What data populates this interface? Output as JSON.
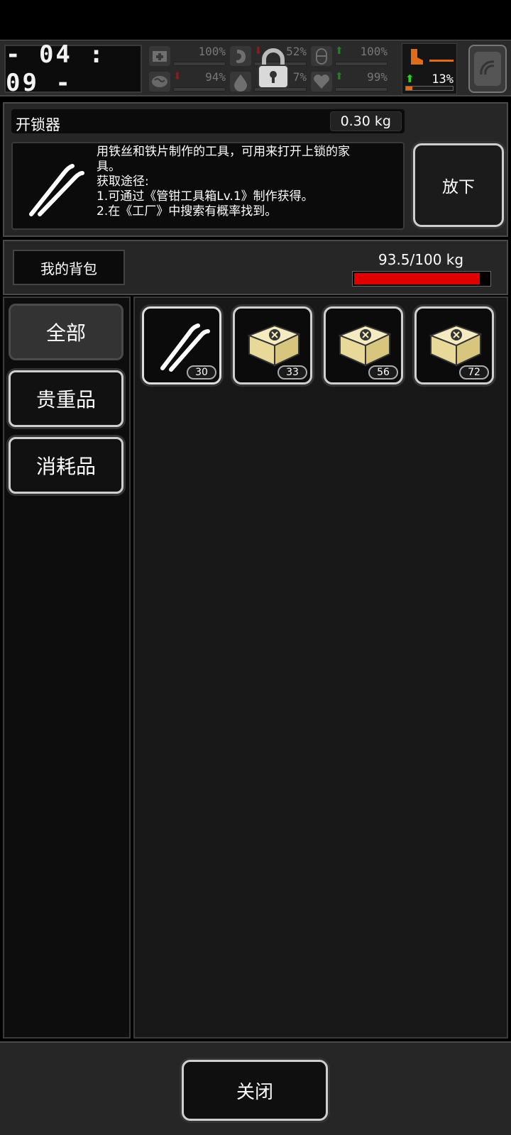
{
  "hud": {
    "clock": "- 04 : 09 -",
    "stats": [
      {
        "name": "health",
        "icon": "medkit-icon",
        "value": "100%",
        "arrow": ""
      },
      {
        "name": "hunger",
        "icon": "stomach-icon",
        "value": "52%",
        "arrow": "down"
      },
      {
        "name": "medicine",
        "icon": "pill-icon",
        "value": "100%",
        "arrow": "up"
      },
      {
        "name": "mental",
        "icon": "brain-icon",
        "value": "94%",
        "arrow": "down"
      },
      {
        "name": "thirst",
        "icon": "water-drop-icon",
        "value": "7%",
        "arrow": ""
      },
      {
        "name": "mood",
        "icon": "heart-icon",
        "value": "99%",
        "arrow": "up"
      }
    ],
    "locked_icon": "padlock-icon",
    "boot": {
      "value": "13%",
      "fraction": 0.13,
      "icon": "boot-icon"
    },
    "radar_icon": "radar-icon"
  },
  "item": {
    "name": "开锁器",
    "weight": "0.30 kg",
    "description": [
      "用铁丝和铁片制作的工具，可用来打开上锁的家",
      "具。",
      "获取途径:",
      "1.可通过《管钳工具箱Lv.1》制作获得。",
      "2.在《工厂》中搜索有概率找到。"
    ],
    "drop_label": "放下"
  },
  "backpack": {
    "tab_label": "我的背包",
    "weight_text": "93.5/100 kg",
    "fill_fraction": 0.935
  },
  "categories": [
    {
      "label": "全部",
      "active": true
    },
    {
      "label": "贵重品",
      "active": false
    },
    {
      "label": "消耗品",
      "active": false
    }
  ],
  "slots": [
    {
      "icon": "lockpick-icon",
      "count": "30"
    },
    {
      "icon": "supply-box-icon",
      "count": "33"
    },
    {
      "icon": "supply-box-icon",
      "count": "56"
    },
    {
      "icon": "supply-box-icon",
      "count": "72"
    }
  ],
  "footer": {
    "close_label": "关闭"
  },
  "colors": {
    "capacity": "#e00000",
    "accent": "#e16c17",
    "up_arrow": "#2bd12b"
  }
}
